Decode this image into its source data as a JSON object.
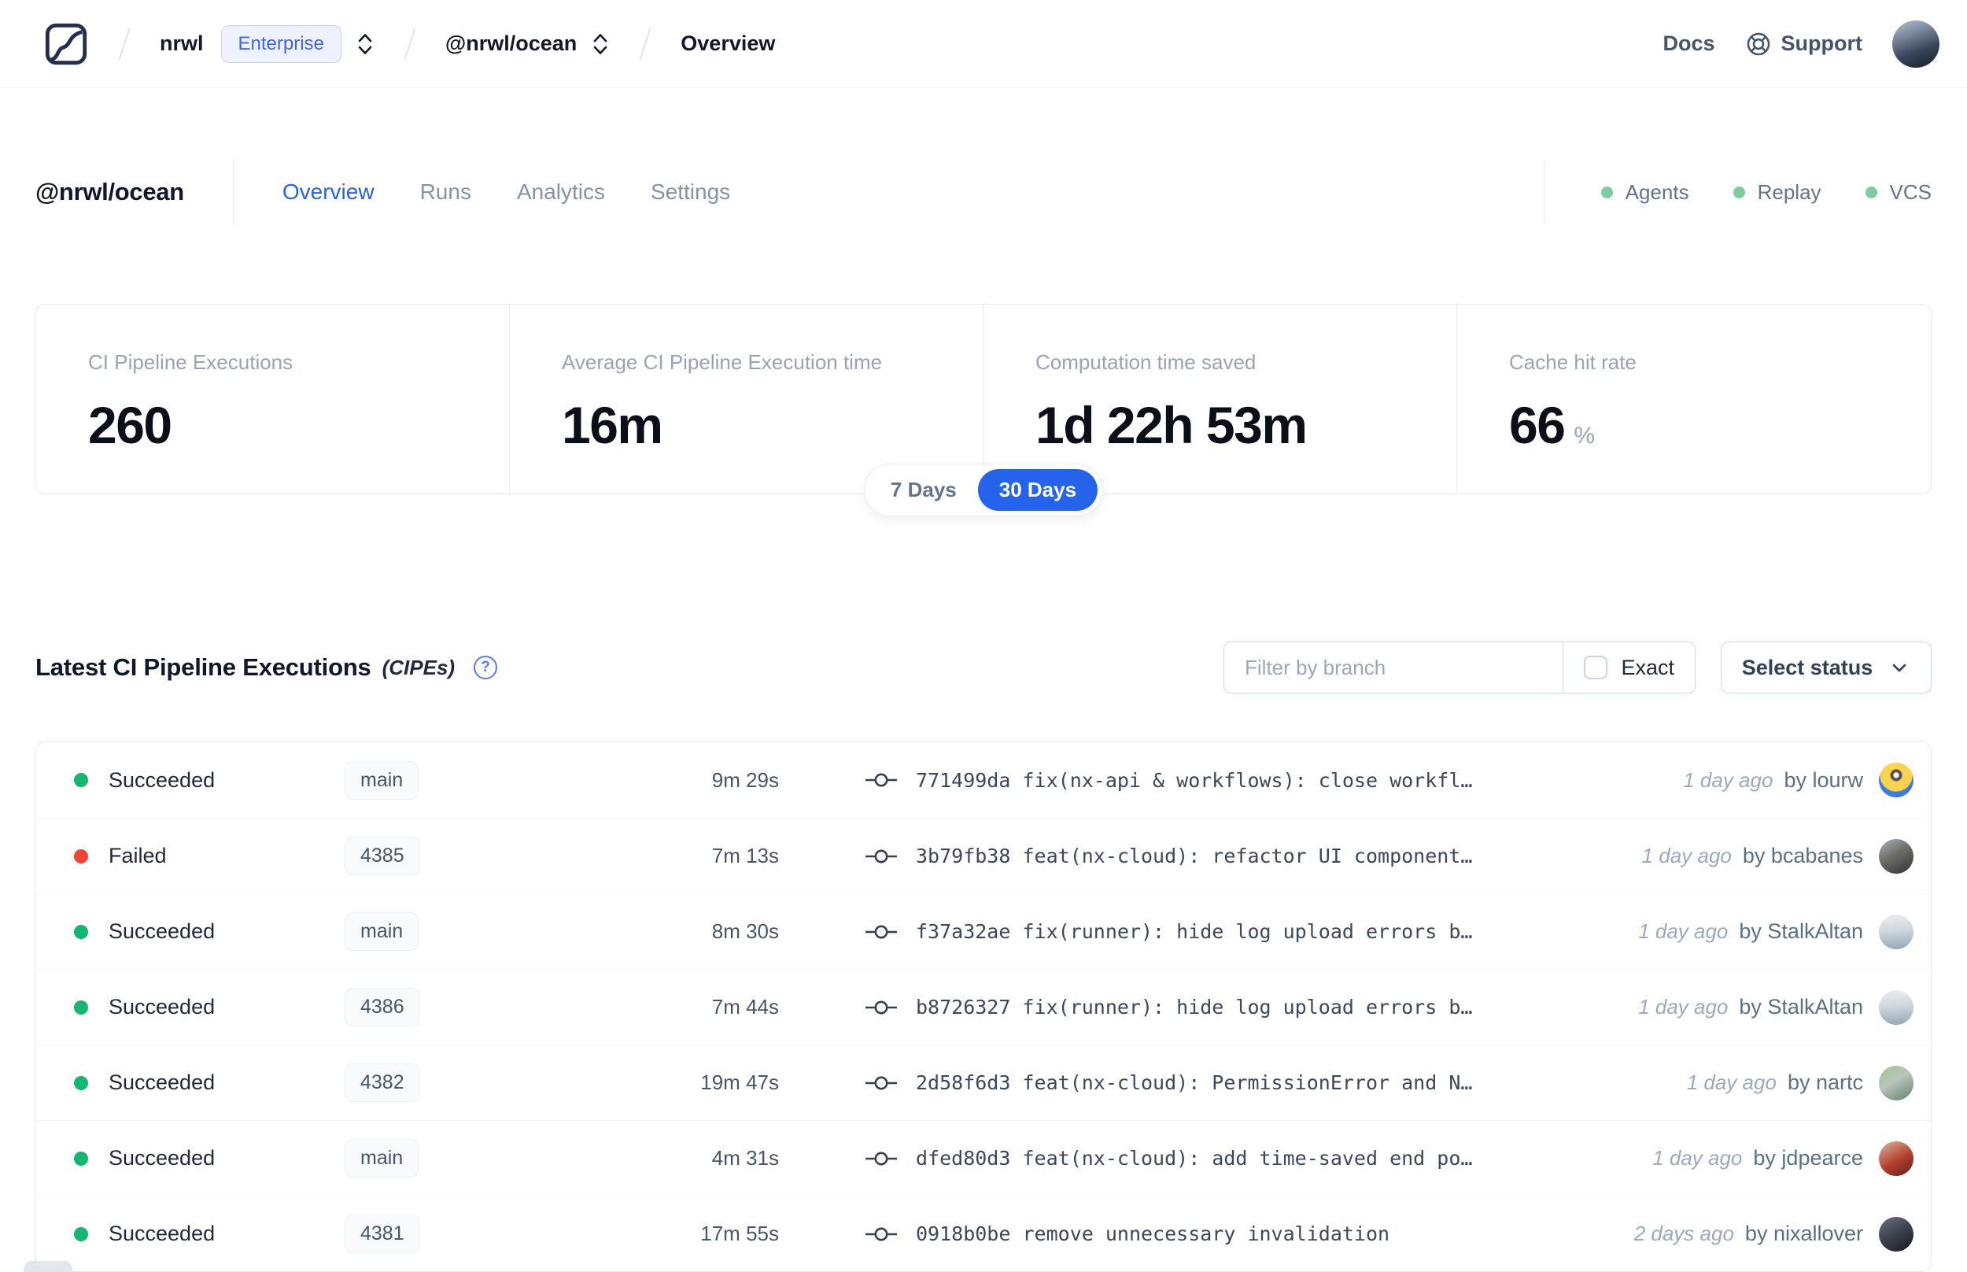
{
  "topbar": {
    "org": "nrwl",
    "org_badge": "Enterprise",
    "workspace": "@nrwl/ocean",
    "page": "Overview",
    "docs_label": "Docs",
    "support_label": "Support"
  },
  "header": {
    "workspace_title": "@nrwl/ocean",
    "tabs": [
      {
        "label": "Overview",
        "active": true
      },
      {
        "label": "Runs",
        "active": false
      },
      {
        "label": "Analytics",
        "active": false
      },
      {
        "label": "Settings",
        "active": false
      }
    ],
    "statuses": [
      {
        "label": "Agents"
      },
      {
        "label": "Replay"
      },
      {
        "label": "VCS"
      }
    ]
  },
  "stats": {
    "cards": [
      {
        "label": "CI Pipeline Executions",
        "value": "260",
        "suffix": ""
      },
      {
        "label": "Average CI Pipeline Execution time",
        "value": "16m",
        "suffix": ""
      },
      {
        "label": "Computation time saved",
        "value": "1d 22h 53m",
        "suffix": ""
      },
      {
        "label": "Cache hit rate",
        "value": "66",
        "suffix": "%"
      }
    ],
    "range_toggle": {
      "options": [
        "7 Days",
        "30 Days"
      ],
      "selected": "30 Days"
    }
  },
  "cipes": {
    "title": "Latest CI Pipeline Executions",
    "title_suffix": "(CIPEs)",
    "help_glyph": "?",
    "filter_placeholder": "Filter by branch",
    "exact_label": "Exact",
    "status_select_label": "Select status",
    "by_label": "by",
    "rows": [
      {
        "status": "Succeeded",
        "status_color": "success",
        "branch": "main",
        "duration": "9m 29s",
        "commit_hash": "771499da",
        "commit_message": "fix(nx-api & workflows): close workfl…",
        "time_ago": "1 day ago",
        "author": "lourw",
        "avatar": "lourw"
      },
      {
        "status": "Failed",
        "status_color": "failed",
        "branch": "4385",
        "duration": "7m 13s",
        "commit_hash": "3b79fb38",
        "commit_message": "feat(nx-cloud): refactor UI component…",
        "time_ago": "1 day ago",
        "author": "bcabanes",
        "avatar": "bcabanes"
      },
      {
        "status": "Succeeded",
        "status_color": "success",
        "branch": "main",
        "duration": "8m 30s",
        "commit_hash": "f37a32ae",
        "commit_message": "fix(runner): hide log upload errors b…",
        "time_ago": "1 day ago",
        "author": "StalkAltan",
        "avatar": "stalkaltan"
      },
      {
        "status": "Succeeded",
        "status_color": "success",
        "branch": "4386",
        "duration": "7m 44s",
        "commit_hash": "b8726327",
        "commit_message": "fix(runner): hide log upload errors b…",
        "time_ago": "1 day ago",
        "author": "StalkAltan",
        "avatar": "stalkaltan"
      },
      {
        "status": "Succeeded",
        "status_color": "success",
        "branch": "4382",
        "duration": "19m 47s",
        "commit_hash": "2d58f6d3",
        "commit_message": "feat(nx-cloud): PermissionError and N…",
        "time_ago": "1 day ago",
        "author": "nartc",
        "avatar": "nartc"
      },
      {
        "status": "Succeeded",
        "status_color": "success",
        "branch": "main",
        "duration": "4m 31s",
        "commit_hash": "dfed80d3",
        "commit_message": "feat(nx-cloud): add time-saved end po…",
        "time_ago": "1 day ago",
        "author": "jdpearce",
        "avatar": "jdpearce"
      },
      {
        "status": "Succeeded",
        "status_color": "success",
        "branch": "4381",
        "duration": "17m 55s",
        "commit_hash": "0918b0be",
        "commit_message": "remove unnecessary invalidation",
        "time_ago": "2 days ago",
        "author": "nixallover",
        "avatar": "nixallover"
      }
    ]
  },
  "colors": {
    "accent_blue": "#2563eb",
    "status": {
      "success": "#13b76f",
      "failed": "#f04438"
    },
    "header_dot": "#7ecda0",
    "enterprise_text": "#4263eb",
    "enterprise_bg": "#eef2ff"
  }
}
